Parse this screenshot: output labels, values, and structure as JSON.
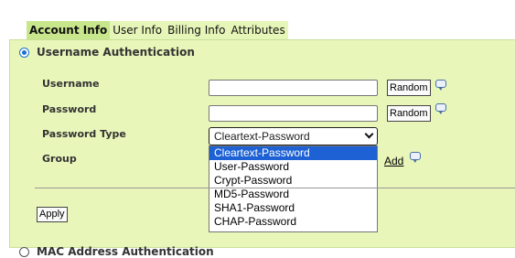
{
  "tabs": [
    {
      "label": "Account Info",
      "active": true
    },
    {
      "label": "User Info"
    },
    {
      "label": "Billing Info"
    },
    {
      "label": "Attributes"
    }
  ],
  "username_auth": {
    "title": "Username Authentication",
    "selected": true,
    "fields": {
      "username_label": "Username",
      "username_value": "",
      "password_label": "Password",
      "password_value": "",
      "password_type_label": "Password Type",
      "password_type_value": "Cleartext-Password",
      "group_label": "Group"
    },
    "random_label": "Random",
    "add_label": "Add",
    "password_type_options": [
      "Cleartext-Password",
      "User-Password",
      "Crypt-Password",
      "MD5-Password",
      "SHA1-Password",
      "CHAP-Password"
    ],
    "apply_label": "Apply"
  },
  "mac_auth": {
    "title": "MAC Address Authentication",
    "selected": false
  },
  "colors": {
    "panel_bg": "#e8f6b9",
    "active_tab_bg": "#c8e68c",
    "selected_option_bg": "#1e61d4"
  },
  "icons": [
    "radio-selected-icon",
    "help-bubble-icon",
    "chevron-down-icon"
  ]
}
